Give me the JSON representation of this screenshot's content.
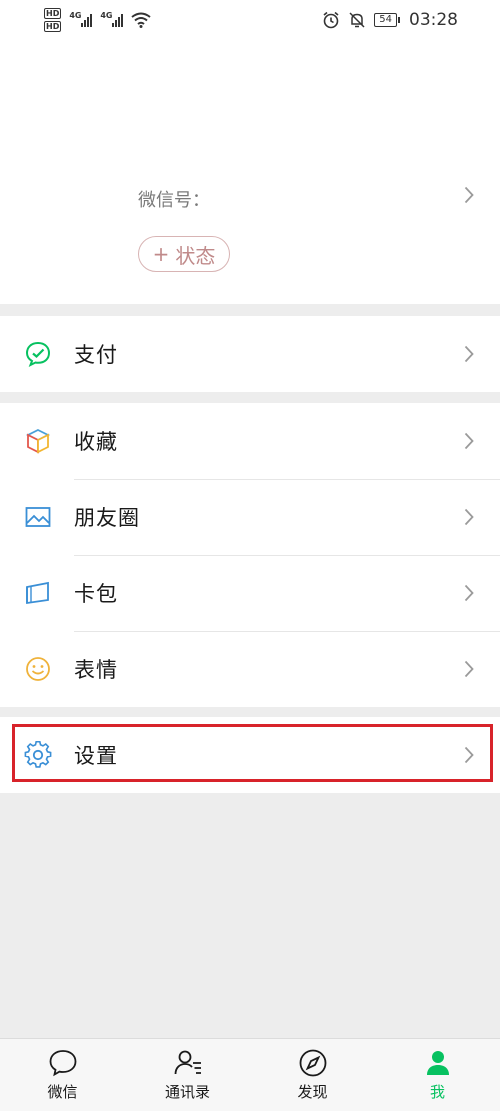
{
  "status_bar": {
    "hd1": "HD",
    "hd2": "HD",
    "net1": "4G",
    "net2": "4G",
    "battery": "54",
    "time": "03:28"
  },
  "profile": {
    "wechat_id_label": "微信号：",
    "status_button": "状态",
    "status_plus": "+"
  },
  "menu": {
    "pay": {
      "label": "支付",
      "icon": "wechat-pay-icon"
    },
    "favorites": {
      "label": "收藏",
      "icon": "cube-icon"
    },
    "moments": {
      "label": "朋友圈",
      "icon": "picture-icon"
    },
    "cards": {
      "label": "卡包",
      "icon": "card-icon"
    },
    "stickers": {
      "label": "表情",
      "icon": "smiley-icon"
    },
    "settings": {
      "label": "设置",
      "icon": "gear-icon"
    }
  },
  "tabbar": {
    "tabs": [
      {
        "label": "微信",
        "icon": "chat-bubble-icon"
      },
      {
        "label": "通讯录",
        "icon": "contacts-icon"
      },
      {
        "label": "发现",
        "icon": "compass-icon"
      },
      {
        "label": "我",
        "icon": "person-icon"
      }
    ],
    "active": 3
  },
  "colors": {
    "accent": "#07c160",
    "highlight": "#d8232a",
    "background": "#ededed"
  }
}
